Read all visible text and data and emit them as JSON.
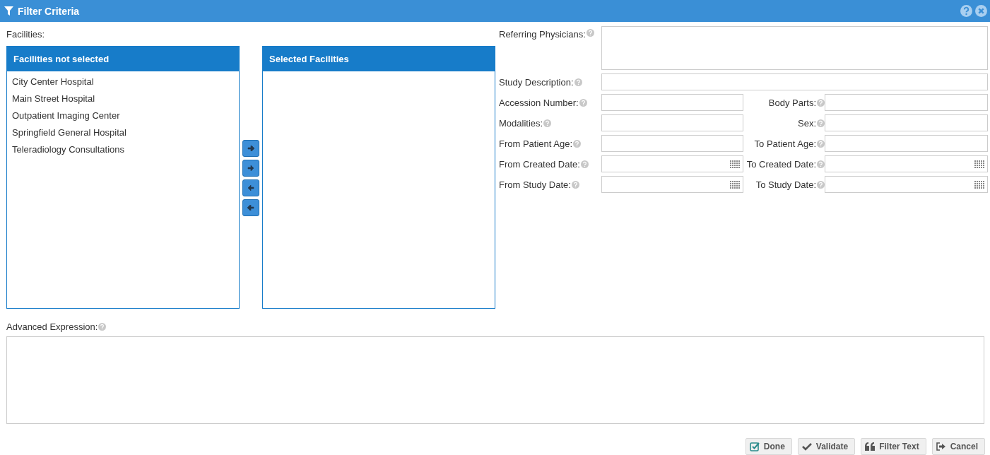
{
  "window": {
    "title": "Filter Criteria"
  },
  "facilities": {
    "label": "Facilities:",
    "available": {
      "title": "Facilities not selected",
      "items": [
        "City Center Hospital",
        "Main Street Hospital",
        "Outpatient Imaging Center",
        "Springfield General Hospital",
        "Teleradiology Consultations"
      ]
    },
    "selected": {
      "title": "Selected Facilities"
    }
  },
  "form_rows": [
    {
      "left": {
        "label": "Referring Physicians:",
        "kind": "textarea"
      }
    },
    {
      "left": {
        "label": "Study Description:",
        "kind": "wide"
      }
    },
    {
      "left": {
        "label": "Accession Number:",
        "kind": "text"
      },
      "right": {
        "label": "Body Parts:",
        "kind": "text"
      }
    },
    {
      "left": {
        "label": "Modalities:",
        "kind": "text"
      },
      "right": {
        "label": "Sex:",
        "kind": "text"
      }
    },
    {
      "left": {
        "label": "From Patient Age:",
        "kind": "text"
      },
      "right": {
        "label": "To Patient Age:",
        "kind": "text"
      }
    },
    {
      "left": {
        "label": "From Created Date:",
        "kind": "date"
      },
      "right": {
        "label": "To Created Date:",
        "kind": "date"
      }
    },
    {
      "left": {
        "label": "From Study Date:",
        "kind": "date"
      },
      "right": {
        "label": "To Study Date:",
        "kind": "date"
      }
    }
  ],
  "advanced_expression": {
    "label": "Advanced Expression:"
  },
  "buttons": [
    {
      "label": "Done",
      "kind": "done"
    },
    {
      "label": "Validate",
      "kind": "validate"
    },
    {
      "label": "Filter Text",
      "kind": "filter-text"
    },
    {
      "label": "Cancel",
      "kind": "cancel"
    }
  ]
}
